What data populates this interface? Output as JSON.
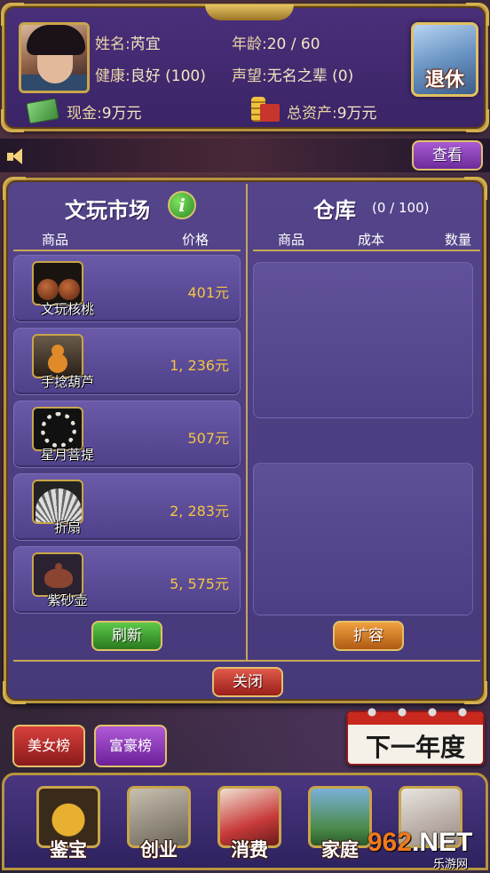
{
  "player": {
    "name_label": "姓名:",
    "name": "芮宜",
    "age_label": "年龄:",
    "age": "20 / 60",
    "health_label": "健康:",
    "health": "良好 (100)",
    "reputation_label": "声望:",
    "reputation": "无名之辈 (0)",
    "cash_label": "现金:",
    "cash": "9万元",
    "assets_label": "总资产:",
    "assets": "9万元",
    "retire_label": "退休"
  },
  "announce": {
    "view_label": "查看"
  },
  "market": {
    "title": "文玩市场",
    "info_icon": "i",
    "col_goods": "商品",
    "col_price": "价格",
    "items": [
      {
        "name": "文玩核桃",
        "price": "401元"
      },
      {
        "name": "手捻葫芦",
        "price": "1, 236元"
      },
      {
        "name": "星月菩提",
        "price": "507元"
      },
      {
        "name": "折扇",
        "price": "2, 283元"
      },
      {
        "name": "紫砂壶",
        "price": "5, 575元"
      }
    ],
    "refresh_label": "刷新"
  },
  "warehouse": {
    "title": "仓库",
    "capacity": "(0 / 100)",
    "col_goods": "商品",
    "col_cost": "成本",
    "col_qty": "数量",
    "expand_label": "扩容"
  },
  "dialog": {
    "close_label": "关闭"
  },
  "rankings": {
    "beauty_label": "美女榜",
    "rich_label": "富豪榜"
  },
  "next_year_label": "下一年度",
  "nav": [
    {
      "label": "鉴宝",
      "icon": "vase-icon"
    },
    {
      "label": "创业",
      "icon": "business-icon"
    },
    {
      "label": "消费",
      "icon": "shopping-icon"
    },
    {
      "label": "家庭",
      "icon": "family-icon"
    },
    {
      "label": "",
      "icon": "handshake-icon"
    }
  ],
  "watermark": {
    "brand_num": "962",
    "brand_suffix": ".NET",
    "subtitle": "乐游网"
  },
  "colors": {
    "panel_purple": "#4a2f7a",
    "gold_border": "#b8953e",
    "price_gold": "#f5c542"
  }
}
